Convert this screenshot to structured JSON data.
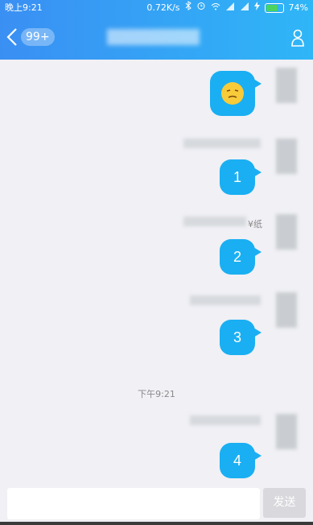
{
  "status_bar": {
    "time": "晚上9:21",
    "net_speed": "0.72K/s",
    "battery_percent": "74%",
    "battery_level": 0.74,
    "icons": [
      "bluetooth-icon",
      "alarm-icon",
      "wifi-icon",
      "signal-icon",
      "signal-icon",
      "charging-icon",
      "battery-icon"
    ]
  },
  "header": {
    "back_icon": "chevron-left-icon",
    "unread_badge": "99+",
    "contact_icon": "person-icon",
    "accent_gradient": [
      "#3a8ff3",
      "#2fb6f7"
    ]
  },
  "messages": [
    {
      "type": "emoji",
      "emoji": "smirk-emoji"
    },
    {
      "type": "text",
      "text": "1"
    },
    {
      "type": "text",
      "text": "2",
      "sender_fragment": "¥纸"
    },
    {
      "type": "text",
      "text": "3"
    },
    {
      "type": "time",
      "text": "下午9:21"
    },
    {
      "type": "text",
      "text": "4"
    }
  ],
  "input": {
    "placeholder": "",
    "send_label": "发送"
  },
  "colors": {
    "bubble": "#1aaff2",
    "background": "#f0f0f5"
  }
}
